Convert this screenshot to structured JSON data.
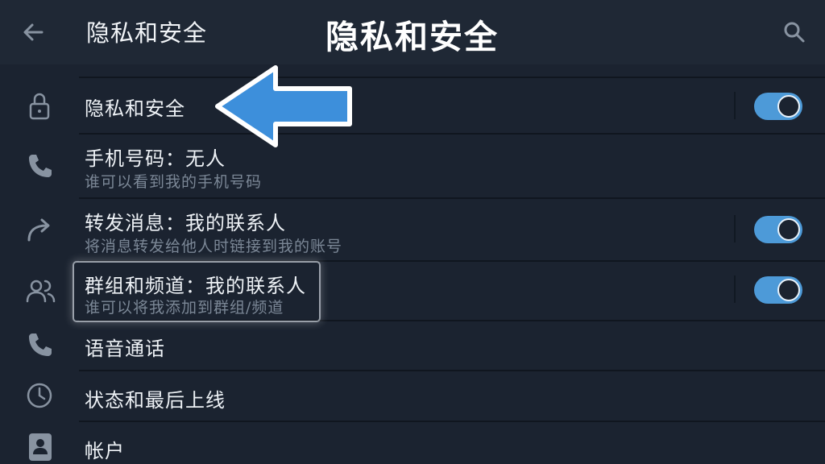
{
  "header": {
    "title": "隐私和安全",
    "big_title": "隐私和安全",
    "back_icon": "arrow-left-icon",
    "search_icon": "search-icon"
  },
  "rows": [
    {
      "icon": "lock-icon",
      "title": "隐私和安全",
      "subtitle": "",
      "toggle": true
    },
    {
      "icon": "phone-icon",
      "title": "手机号码：无人",
      "subtitle": "谁可以看到我的手机号码",
      "toggle": false
    },
    {
      "icon": "forward-icon",
      "title": "转发消息：我的联系人",
      "subtitle": "将消息转发给他人时链接到我的账号",
      "toggle": true
    },
    {
      "icon": "group-icon",
      "title": "群组和频道：我的联系人",
      "subtitle": "谁可以将我添加到群组/频道",
      "toggle": true
    },
    {
      "icon": "phone-icon",
      "title": "语音通话",
      "subtitle": "",
      "toggle": false
    },
    {
      "icon": "clock-icon",
      "title": "状态和最后上线",
      "subtitle": "",
      "toggle": false
    },
    {
      "icon": "account-icon",
      "title": "帐户",
      "subtitle": "",
      "toggle": false
    }
  ],
  "colors": {
    "background": "#1b2330",
    "header": "#1f2835",
    "accent": "#4d9ad8",
    "arrow": "#3d8fdb",
    "subtitle": "#7b8796"
  }
}
